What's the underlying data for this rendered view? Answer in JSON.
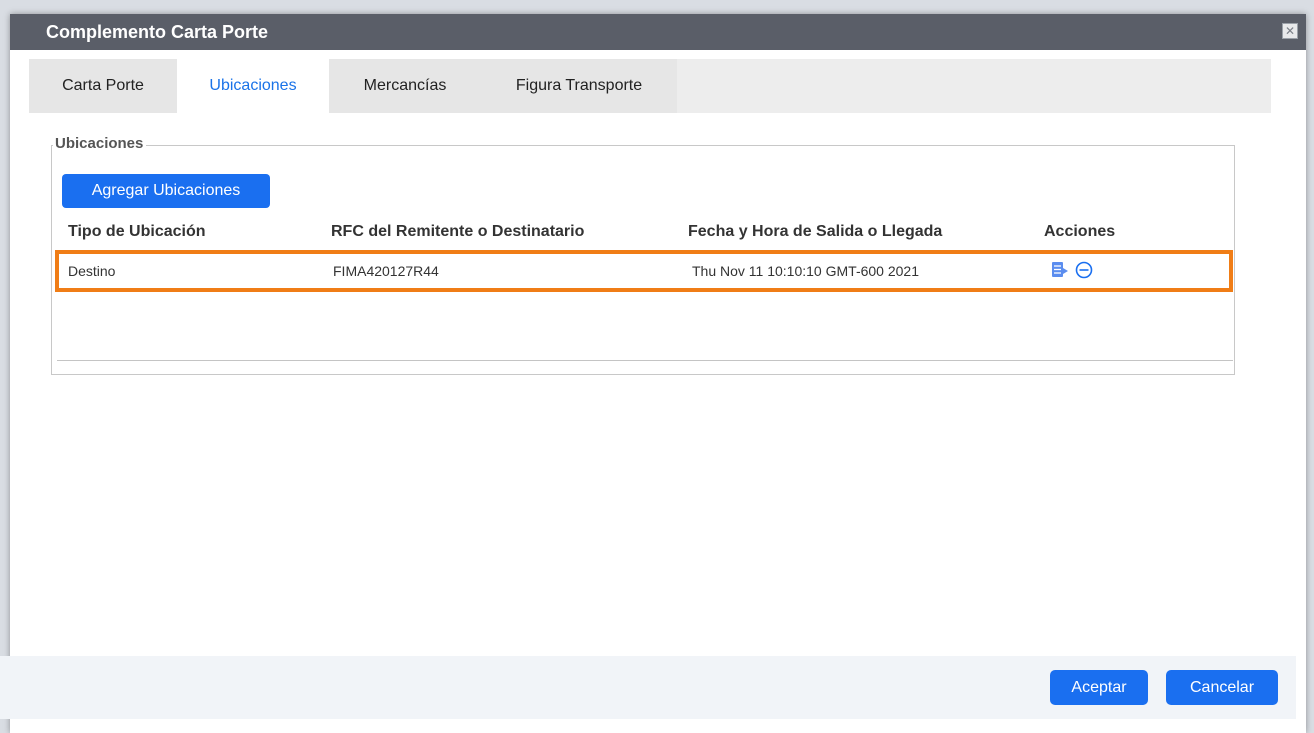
{
  "dialog": {
    "title": "Complemento Carta Porte",
    "close_glyph": "✕"
  },
  "tabs": [
    {
      "label": "Carta Porte",
      "active": false
    },
    {
      "label": "Ubicaciones",
      "active": true
    },
    {
      "label": "Mercancías",
      "active": false
    },
    {
      "label": "Figura Transporte",
      "active": false
    }
  ],
  "section": {
    "legend": "Ubicaciones",
    "add_button": "Agregar Ubicaciones"
  },
  "table": {
    "columns": [
      "Tipo de Ubicación",
      "RFC del Remitente o Destinatario",
      "Fecha y Hora de Salida o Llegada",
      "Acciones"
    ],
    "rows": [
      {
        "tipo": "Destino",
        "rfc": "FIMA420127R44",
        "fecha": "Thu Nov 11 10:10:10 GMT-600 2021",
        "actions": [
          "edit-icon",
          "remove-icon"
        ]
      }
    ]
  },
  "footer": {
    "accept": "Aceptar",
    "cancel": "Cancelar"
  },
  "colors": {
    "accent": "#1a6ff0",
    "highlight": "#f07d16",
    "titlebar": "#5a5e68"
  }
}
